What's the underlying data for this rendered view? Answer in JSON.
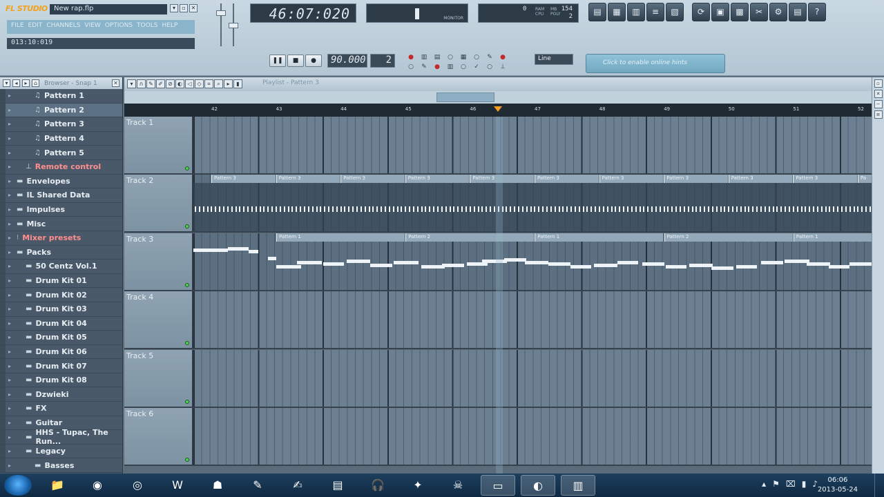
{
  "app": {
    "logo": "FL STUDIO",
    "project_file": "New rap.flp",
    "window_buttons": [
      "▾",
      "▫",
      "✕"
    ],
    "menu": [
      "FILE",
      "EDIT",
      "CHANNELS",
      "VIEW",
      "OPTIONS",
      "TOOLS",
      "HELP"
    ],
    "hint_time": "013:10:019"
  },
  "lcd": {
    "song_time": "46:07:020",
    "meter_label": "MONITOR",
    "cpu_value": "0",
    "ram_label": "RAM",
    "cpu_label": "CPU",
    "poly_label": "POLY",
    "cpu_count": "154",
    "poly_count": "2",
    "mb_label": "MB"
  },
  "toolbar_icons": [
    "▤",
    "▦",
    "▥",
    "≡",
    "▧",
    "⟳",
    "▣",
    "▩",
    "✂",
    "⚙",
    "▤",
    "?"
  ],
  "transport": {
    "pause": "❚❚",
    "stop": "■",
    "record": "●",
    "tempo": "90.000",
    "pattern_number": "2",
    "snap": "Line",
    "hint_bar": "Click to enable online hints"
  },
  "browser": {
    "title": "Browser - Snap 1",
    "items": [
      {
        "label": "Pattern 1",
        "icon": "♫",
        "indent": 2
      },
      {
        "label": "Pattern 2",
        "icon": "♫",
        "indent": 2,
        "selected": true
      },
      {
        "label": "Pattern 3",
        "icon": "♫",
        "indent": 2
      },
      {
        "label": "Pattern 4",
        "icon": "♫",
        "indent": 2
      },
      {
        "label": "Pattern 5",
        "icon": "♫",
        "indent": 2
      },
      {
        "label": "Remote control",
        "icon": "⊥",
        "indent": 1,
        "red": true
      },
      {
        "label": "Envelopes",
        "icon": "▬",
        "indent": 0
      },
      {
        "label": "IL Shared Data",
        "icon": "▬",
        "indent": 0
      },
      {
        "label": "Impulses",
        "icon": "▬",
        "indent": 0
      },
      {
        "label": "Misc",
        "icon": "▬",
        "indent": 0
      },
      {
        "label": "Mixer presets",
        "icon": "⁝",
        "indent": 0,
        "red": true
      },
      {
        "label": "Packs",
        "icon": "▬",
        "indent": 0
      },
      {
        "label": "50 Centz Vol.1",
        "icon": "▬",
        "indent": 1
      },
      {
        "label": "Drum Kit 01",
        "icon": "▬",
        "indent": 1
      },
      {
        "label": "Drum Kit 02",
        "icon": "▬",
        "indent": 1
      },
      {
        "label": "Drum Kit 03",
        "icon": "▬",
        "indent": 1
      },
      {
        "label": "Drum Kit 04",
        "icon": "▬",
        "indent": 1
      },
      {
        "label": "Drum Kit 05",
        "icon": "▬",
        "indent": 1
      },
      {
        "label": "Drum Kit 06",
        "icon": "▬",
        "indent": 1
      },
      {
        "label": "Drum Kit 07",
        "icon": "▬",
        "indent": 1
      },
      {
        "label": "Drum Kit 08",
        "icon": "▬",
        "indent": 1
      },
      {
        "label": "Dzwieki",
        "icon": "▬",
        "indent": 1
      },
      {
        "label": "FX",
        "icon": "▬",
        "indent": 1
      },
      {
        "label": "Guitar",
        "icon": "▬",
        "indent": 1
      },
      {
        "label": "HHS - Tupac, The Run...",
        "icon": "▬",
        "indent": 1
      },
      {
        "label": "Legacy",
        "icon": "▬",
        "indent": 1
      },
      {
        "label": "Basses",
        "icon": "▬",
        "indent": 2
      }
    ]
  },
  "playlist": {
    "title": "Playlist - Pattern 3",
    "bars": [
      "42",
      "43",
      "44",
      "45",
      "46",
      "47",
      "48",
      "49",
      "50",
      "51",
      "52"
    ],
    "tracks": [
      "Track 1",
      "Track 2",
      "Track 3",
      "Track 4",
      "Track 5",
      "Track 6"
    ],
    "track2_clips": [
      "Pattern 3",
      "Pattern 3",
      "Pattern 3",
      "Pattern 3",
      "Pattern 3",
      "Pattern 3",
      "Pattern 3",
      "Pattern 3",
      "Pattern 3",
      "Pattern 3",
      "Pa"
    ],
    "track3_clips": [
      "Pattern 1",
      "Pattern 2",
      "Pattern 1",
      "Pattern 2",
      "Pattern 1"
    ]
  },
  "taskbar": {
    "apps": [
      "📁",
      "◉",
      "◎",
      "W",
      "☗",
      "✎",
      "✍",
      "▤",
      "🎧",
      "✦",
      "☠",
      "▭",
      "◐",
      "▥"
    ],
    "clock_time": "06:06",
    "clock_date": "2013-05-24"
  }
}
